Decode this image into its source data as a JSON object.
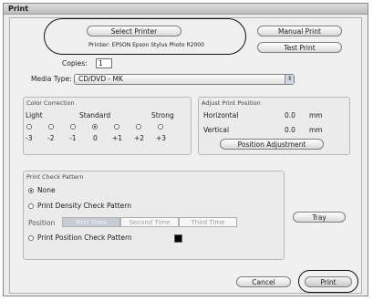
{
  "window": {
    "title": "Print"
  },
  "buttons": {
    "select_printer": "Select Printer",
    "manual_print": "Manual Print",
    "test_print": "Test Print",
    "position_adjustment": "Position Adjustment",
    "tray": "Tray",
    "cancel": "Cancel",
    "print": "Print"
  },
  "printer": {
    "label": "Printer:",
    "name": "EPSON Epson Stylus Photo R2000"
  },
  "copies": {
    "label": "Copies:",
    "value": "1"
  },
  "media_type": {
    "label": "Media Type:",
    "value": "CD/DVD - MK",
    "arrow": "⇕"
  },
  "color_correction": {
    "title": "Color Correction",
    "light": "Light",
    "standard": "Standard",
    "strong": "Strong",
    "levels": [
      "-3",
      "-2",
      "-1",
      "0",
      "+1",
      "+2",
      "+3"
    ],
    "selected_level": "0"
  },
  "adjust_position": {
    "title": "Adjust Print Position",
    "horizontal_label": "Horizontal",
    "horizontal_value": "0.0",
    "vertical_label": "Vertical",
    "vertical_value": "0.0",
    "unit": "mm"
  },
  "check_pattern": {
    "title": "Print Check Pattern",
    "none": "None",
    "density": "Print Density Check Pattern",
    "position_label": "Position",
    "times": [
      "First Time",
      "Second Time",
      "Third Time"
    ],
    "position_check": "Print Position Check Pattern",
    "selected": "None"
  }
}
